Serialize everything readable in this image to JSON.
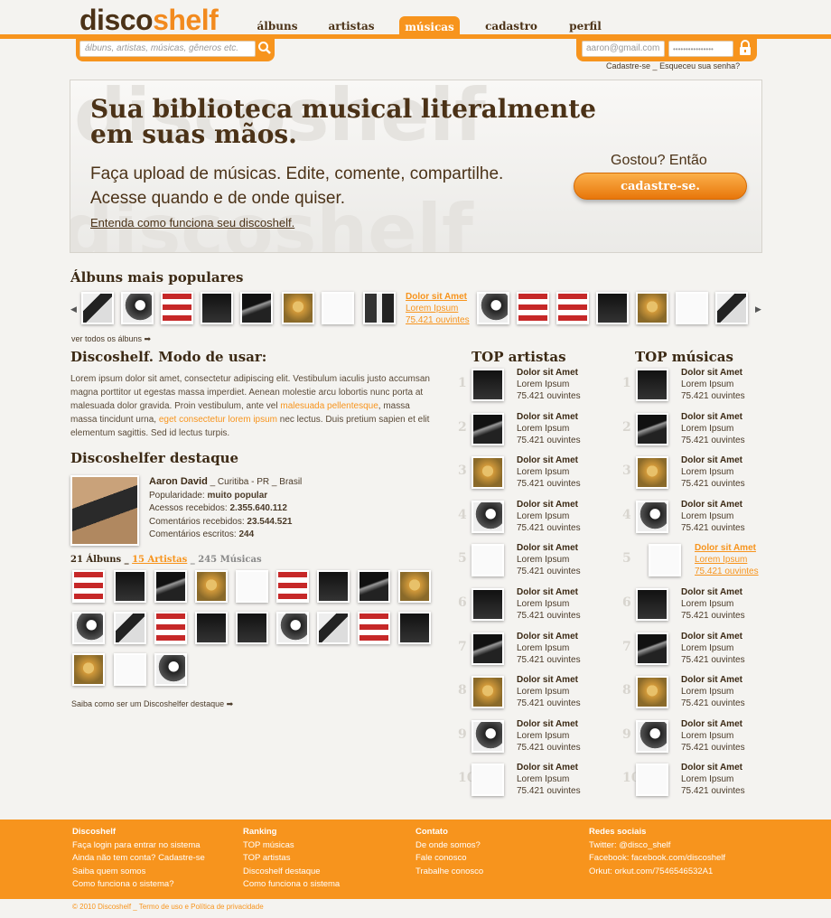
{
  "logo": {
    "part1": "disco",
    "part2": "shelf"
  },
  "nav": [
    "álbuns",
    "artistas",
    "músicas",
    "cadastro",
    "perfil"
  ],
  "search": {
    "placeholder": "álbuns, artistas, músicas, gêneros etc."
  },
  "login": {
    "email": "aaron@gmail.com",
    "password": "••••••••••••••••",
    "register": "Cadastre-se",
    "sep": "_",
    "forgot": "Esqueceu sua senha?"
  },
  "hero": {
    "bg_text": "discoshelf",
    "title": "Sua biblioteca musical literalmente em suas mãos.",
    "subtitle": "Faça upload de músicas. Edite, comente, compartilhe. Acesse quando e de onde quiser.",
    "link": "Entenda como funciona seu discoshelf.",
    "cta_label": "Gostou? Então",
    "cta_button": "cadastre-se."
  },
  "popular": {
    "title": "Álbuns mais populares",
    "info": {
      "title": "Dolor sit Amet",
      "subtitle": "Lorem Ipsum",
      "listeners": "75.421 ouvintes"
    },
    "view_all": "ver todos os álbuns ➡"
  },
  "howto": {
    "title": "Discoshelf. Modo de usar:",
    "p1": "Lorem ipsum dolor sit amet, consectetur adipiscing elit. Vestibulum iaculis justo accumsan magna porttitor ut egestas massa imperdiet. Aenean molestie arcu lobortis nunc porta at malesuada dolor gravida. Proin vestibulum, ante vel ",
    "link1": "malesuada pellentesque",
    "p2": ", massa massa tincidunt urna, ",
    "link2": "eget consectetur lorem ipsum",
    "p3": " nec lectus. Duis pretium sapien et elit elementum sagittis. Sed id lectus turpis."
  },
  "featured": {
    "title": "Discoshelfer destaque",
    "name": "Aaron David",
    "location": " _ Curitiba - PR _ Brasil",
    "pop_label": "Popularidade: ",
    "pop_value": "muito popular",
    "acc_label": "Acessos recebidos: ",
    "acc_value": "2.355.640.112",
    "cr_label": "Comentários recebidos: ",
    "cr_value": "23.544.521",
    "ce_label": "Comentários escritos: ",
    "ce_value": "244",
    "albums": "21 Álbuns",
    "sep": " _ ",
    "artists": "15 Artistas",
    "sep2": " _ ",
    "songs": "245 Músicas",
    "more": "Saiba como ser um Discoshelfer destaque ➡"
  },
  "top_artists": {
    "title": "TOP artistas",
    "ranks": [
      "1",
      "2",
      "3",
      "4",
      "5",
      "6",
      "7",
      "8",
      "9",
      "10"
    ],
    "item_title": "Dolor sit Amet",
    "item_sub": "Lorem Ipsum",
    "item_listeners": "75.421 ouvintes"
  },
  "top_songs": {
    "title": "TOP músicas",
    "ranks": [
      "1",
      "2",
      "3",
      "4",
      "5",
      "6",
      "7",
      "8",
      "9",
      "10"
    ],
    "item_title": "Dolor sit Amet",
    "item_sub": "Lorem Ipsum",
    "item_listeners": "75.421 ouvintes"
  },
  "footer": {
    "discoshelf": {
      "title": "Discoshelf",
      "links": [
        "Faça login para entrar no sistema",
        "Ainda não tem conta? Cadastre-se",
        "Saiba quem somos",
        "Como funciona o sistema?"
      ]
    },
    "ranking": {
      "title": "Ranking",
      "links": [
        "TOP músicas",
        "TOP artistas",
        "Discoshelf destaque",
        "Como funciona o sistema"
      ]
    },
    "contato": {
      "title": "Contato",
      "links": [
        "De onde somos?",
        "Fale conosco",
        "Trabalhe conosco"
      ]
    },
    "redes": {
      "title": "Redes sociais",
      "links": [
        "Twitter: @disco_shelf",
        "Facebook: facebook.com/discoshelf",
        "Orkut: orkut.com/7546546532A1"
      ]
    },
    "copyright": "© 2010 Discoshelf _ Termo de uso e Política de privacidade"
  },
  "colors": {
    "accent": "#f7941d",
    "brown": "#4b3217"
  }
}
